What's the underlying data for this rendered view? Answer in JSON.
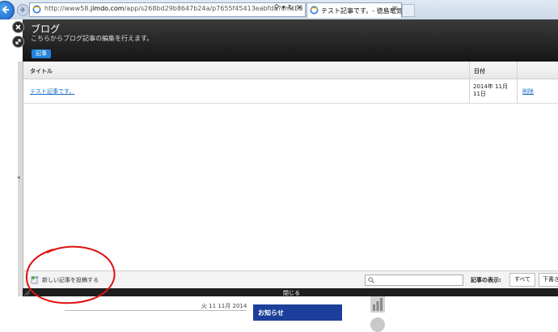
{
  "browser": {
    "url_prefix": "http://www58.",
    "url_host": "jimdo.com",
    "url_rest": "/app/s268bd29b8647b24a/p7655f45413eabfda?cmsEd",
    "tab_title": "テスト記事です。- 徳島竜気..."
  },
  "modal": {
    "title": "ブログ",
    "description": "こちらからブログ記事の編集を行えます。",
    "tab_label": "記事",
    "table": {
      "headers": {
        "title": "タイトル",
        "date": "日付"
      },
      "rows": [
        {
          "title": "テスト記事です。",
          "date": "2014年 11月 11日",
          "action": "削除"
        }
      ]
    },
    "footer": {
      "new_post": "新しい記事を投稿する",
      "search_placeholder": "",
      "display_label": "記事の表示:",
      "filter_all": "すべて",
      "filter_draft": "下書き"
    },
    "close_label": "閉じる"
  },
  "background_page": {
    "date_text": "火 11 11月 2014",
    "notice_label": "お知らせ"
  },
  "colors": {
    "accent_blue": "#2283d9",
    "link_blue": "#1a6fc4",
    "header_dark": "#1e1e1e",
    "notice_navy": "#1b3f9b",
    "annotation_red": "#e01010"
  }
}
